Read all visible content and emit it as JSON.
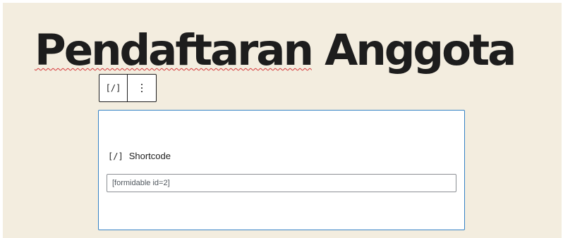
{
  "post": {
    "title_word1": "Pendaftaran",
    "title_word2": "Anggota"
  },
  "block_toolbar": {
    "block_icon": "[/]",
    "block_icon_name": "shortcode-icon",
    "options_icon_name": "kebab-menu-icon"
  },
  "shortcode_block": {
    "icon": "[/]",
    "label": "Shortcode",
    "value": "[formidable id=2]"
  },
  "colors": {
    "editor_background": "#f3eddf",
    "title_text": "#1d1d1d",
    "selection_border": "#3582c4",
    "spellcheck_underline": "#d63638"
  }
}
